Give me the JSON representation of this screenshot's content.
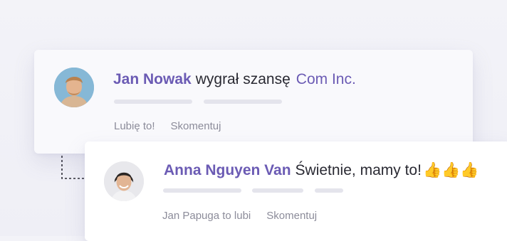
{
  "post": {
    "author": "Jan Nowak",
    "verb": "wygrał szansę",
    "company": "Com Inc.",
    "actions": {
      "like": "Lubię to!",
      "comment": "Skomentuj"
    }
  },
  "reply": {
    "author": "Anna Nguyen Van",
    "text": "Świetnie, mamy to!",
    "emoji": "👍👍👍",
    "actions": {
      "liked_by": "Jan Papuga to lubi",
      "comment": "Skomentuj"
    }
  },
  "colors": {
    "accent": "#6b5bb4",
    "text": "#2a2a33",
    "muted": "#8c8c9a",
    "placeholder_bar": "#e4e4ec"
  }
}
